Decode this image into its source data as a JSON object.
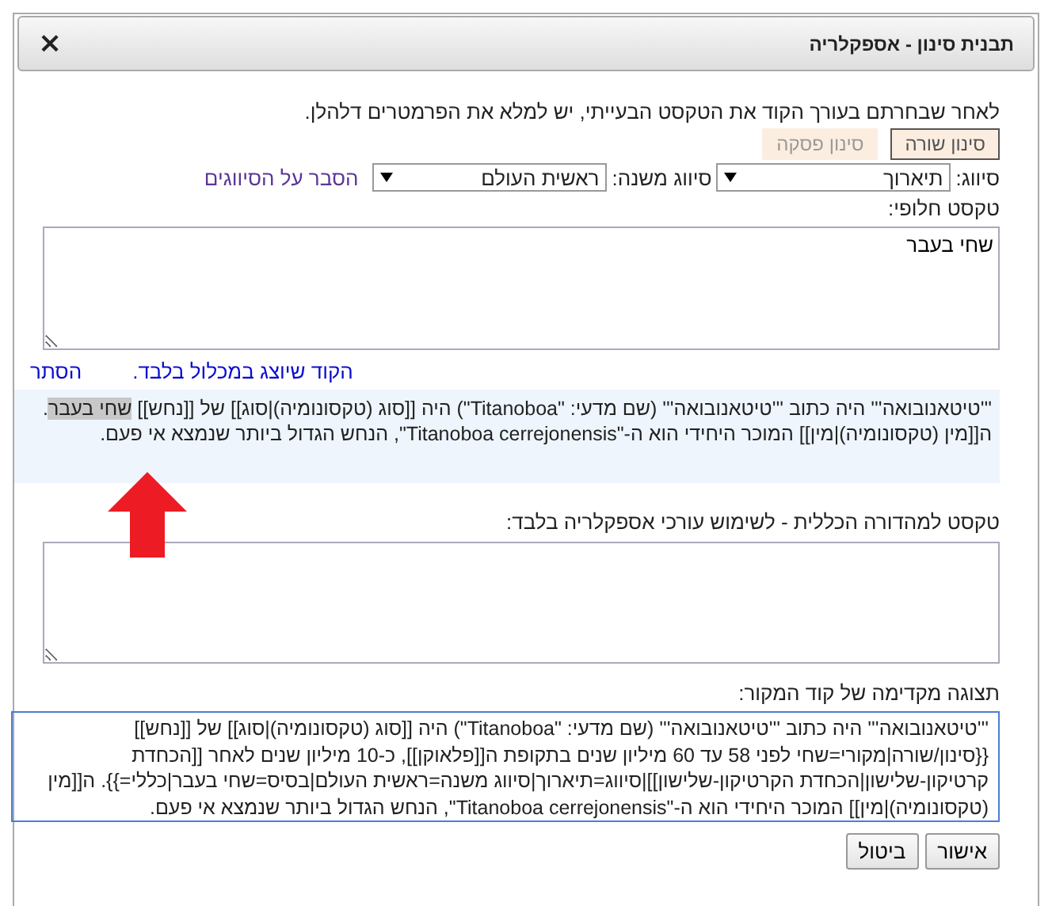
{
  "window": {
    "title": "תבנית סינון - אספקלריה",
    "close": "×"
  },
  "intro": "לאחר שבחרתם בעורך הקוד את הטקסט הבעייתי, יש למלא את הפרמטרים דלהלן.",
  "mode_buttons": [
    {
      "label": "סינון שורה",
      "selected": true
    },
    {
      "label": "סינון פסקה",
      "selected": false
    }
  ],
  "selects": [
    {
      "label": "סיווג:",
      "value": "תיארוך"
    },
    {
      "label": "סיווג משנה:",
      "value": "ראשית העולם"
    }
  ],
  "help_link": "הסבר על הסיווגים",
  "alt_text": {
    "label": "טקסט חלופי:",
    "value": "שחי בעבר"
  },
  "preview_links": [
    {
      "label": "הקוד שיוצג במכלול בלבד."
    },
    {
      "label": "הסתר"
    }
  ],
  "preview": {
    "before": "'''טיטאנובואה''' היה כתוב '''טיטאנובואה''' (שם מדעי: \"Titanoboa\") היה [[סוג (טקסונומיה)|סוג]] של [[נחש]] ",
    "highlight": "שחי בעבר",
    "after": ". ה[[מין (טקסונומיה)|מין]] המוכר היחידי הוא ה-\"Titanoboa cerrejonensis\", הנחש הגדול ביותר שנמצא אי פעם."
  },
  "general_text": {
    "label": "טקסט למהדורה הכללית - לשימוש עורכי אספקלריה בלבד:"
  },
  "source": {
    "label": "תצוגה מקדימה של קוד המקור:",
    "lines": [
      "'''טיטאנובואה''' היה כתוב '''טיטאנובואה''' (שם מדעי: \"Titanoboa\") היה [[סוג (טקסונומיה)|סוג]] של [[נחש]]",
      "{{סינון/שורה|מקורי=שחי לפני 58 עד 60 מיליון שנים בתקופת ה[[פלאוקן]], כ-10 מיליון שנים לאחר [[הכחדת",
      "קרטיקון-שלישון|הכחדת הקרטיקון-שלישון]]|סיווג=תיארוך|סיווג משנה=ראשית העולם|בסיס=שחי בעבר|כללי=}}. ה[[מין",
      "(טקסונומיה)|מין]] המוכר היחידי הוא ה-\"Titanoboa cerrejonensis\", הנחש הגדול ביותר שנמצא אי פעם."
    ]
  },
  "buttons": [
    "אישור",
    "ביטול"
  ]
}
